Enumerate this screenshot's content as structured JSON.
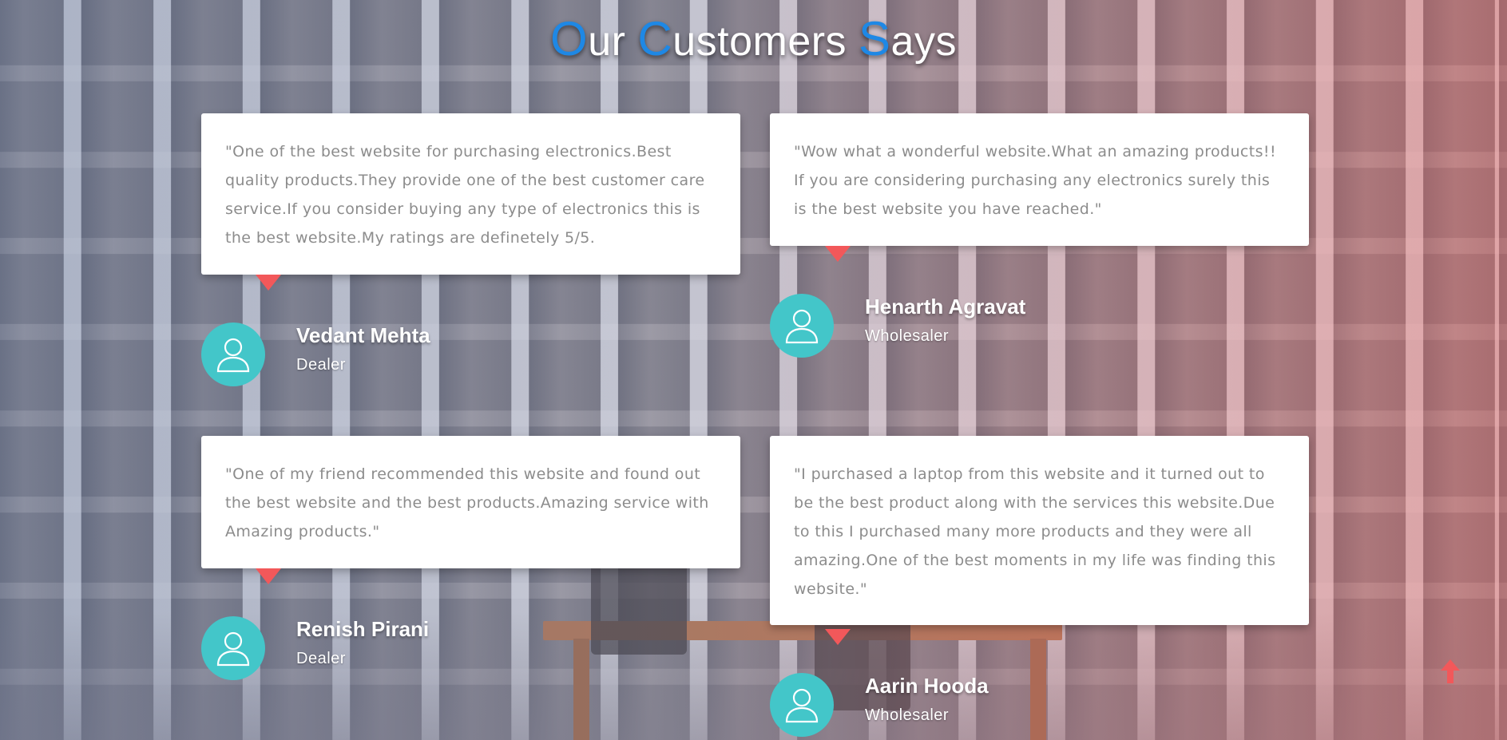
{
  "heading": {
    "w1_first": "O",
    "w1_rest": "ur ",
    "w2_first": "C",
    "w2_rest": "ustomers ",
    "w3_first": "S",
    "w3_rest": "ays"
  },
  "testimonials": [
    {
      "quote": "\"One of the best website for purchasing electronics.Best quality products.They provide one of the best customer care service.If you consider buying any type of electronics this is the best website.My ratings are definetely 5/5.",
      "name": "Vedant Mehta",
      "role": "Dealer"
    },
    {
      "quote": "\"Wow what a wonderful website.What an amazing products!! If you are considering purchasing any electronics surely this is the best website you have reached.\"",
      "name": "Henarth Agravat",
      "role": "Wholesaler"
    },
    {
      "quote": "\"One of my friend recommended this website and found out the best website and the best products.Amazing service with Amazing products.\"",
      "name": "Renish Pirani",
      "role": "Dealer"
    },
    {
      "quote": "\"I purchased a laptop from this website and it turned out to be the best product along with the services this website.Due to this I purchased many more products and they were all amazing.One of the best moments in my life was finding this website.\"",
      "name": "Aarin Hooda",
      "role": "Wholesaler"
    }
  ],
  "icons": {
    "avatar": "user-outline-icon",
    "scroll_top": "arrow-up-icon"
  },
  "colors": {
    "accent_blue": "#1e88e5",
    "pointer_red": "#f2585a",
    "avatar_teal": "#43c6c9",
    "quote_text": "#8c8c8c"
  }
}
